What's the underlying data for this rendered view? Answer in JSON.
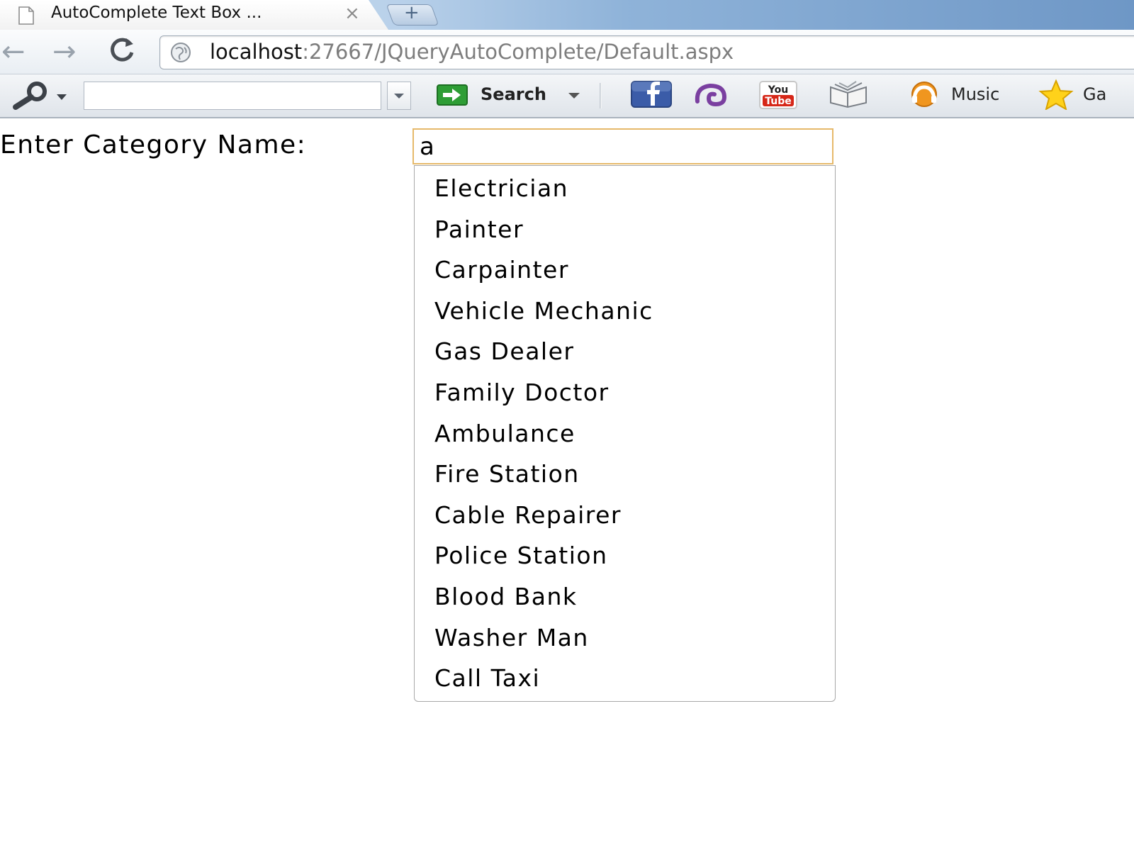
{
  "tab": {
    "title": "AutoComplete Text Box ...",
    "close_glyph": "×",
    "new_tab_glyph": "+"
  },
  "nav": {
    "back_glyph": "←",
    "forward_glyph": "→",
    "reload_glyph": "C",
    "url_host": "localhost",
    "url_path": ":27667/JQueryAutoComplete/Default.aspx"
  },
  "toolbar": {
    "search_value": "",
    "search_label": "Search",
    "music_label": "Music",
    "games_label": "Ga",
    "youtube_text_top": "You",
    "youtube_text_bottom": "Tube"
  },
  "form": {
    "label": "Enter Category Name:",
    "input_value": "a",
    "focus_border_color": "#e6b96a"
  },
  "suggestions": [
    "Electrician",
    "Painter",
    "Carpainter",
    "Vehicle Mechanic",
    "Gas Dealer",
    "Family Doctor",
    "Ambulance",
    "Fire Station",
    "Cable Repairer",
    "Police Station",
    "Blood Bank",
    "Washer Man",
    "Call Taxi"
  ],
  "icons": {
    "tab_page": "page-icon",
    "omnibox": "globe-icon",
    "toolbar_search": "magnifier-icon",
    "toolbar_go": "green-arrow-icon",
    "facebook": "facebook-icon",
    "swirl": "purple-swirl-icon",
    "youtube": "youtube-icon",
    "book": "book-icon",
    "music": "music-icon",
    "star": "star-icon"
  }
}
